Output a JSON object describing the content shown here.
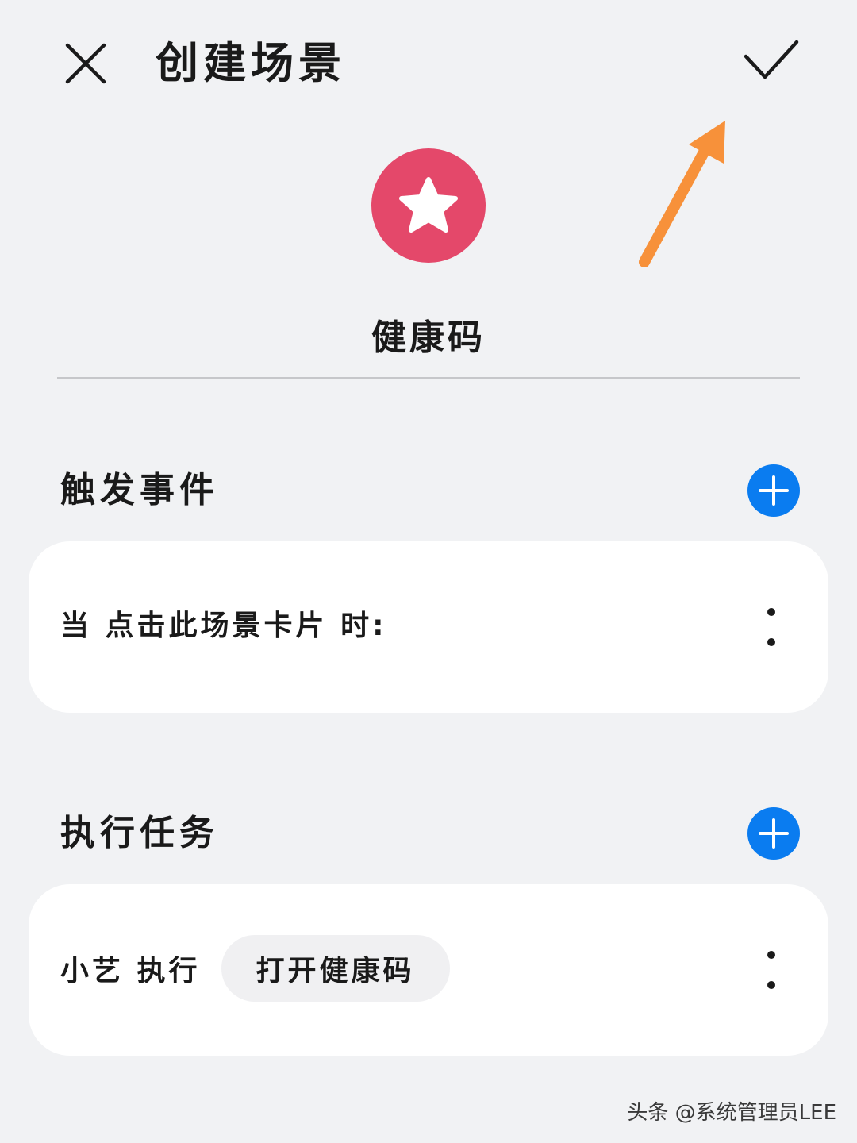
{
  "header": {
    "title": "创建场景",
    "close_icon": "close-icon",
    "confirm_icon": "checkmark-icon"
  },
  "annotation": {
    "arrow_color": "#f7913a"
  },
  "scene": {
    "icon": "star-icon",
    "icon_color": "#e4486a",
    "name": "健康码"
  },
  "trigger": {
    "section_title": "触发事件",
    "card_text": "当 点击此场景卡片 时:"
  },
  "task": {
    "section_title": "执行任务",
    "prefix": "小艺 执行",
    "action": "打开健康码"
  },
  "colors": {
    "accent": "#0a7cf0",
    "background": "#f1f2f4"
  },
  "watermark": "头条 @系统管理员LEE"
}
